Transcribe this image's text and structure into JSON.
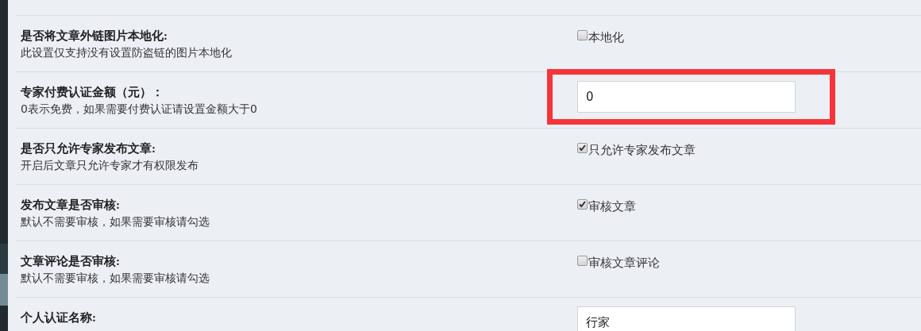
{
  "settings": [
    {
      "title": "是否将文章外链图片本地化:",
      "description": "此设置仅支持没有设置防盗链的图片本地化",
      "kind": "checkbox",
      "checked": false,
      "label": "本地化"
    },
    {
      "title": "专家付费认证金额（元）：",
      "description": "0表示免费，如果需要付费认证请设置金额大于0",
      "kind": "input",
      "value": "0",
      "highlighted": true
    },
    {
      "title": "是否只允许专家发布文章:",
      "description": "开启后文章只允许专家才有权限发布",
      "kind": "checkbox",
      "checked": true,
      "label": "只允许专家发布文章"
    },
    {
      "title": "发布文章是否审核:",
      "description": "默认不需要审核，如果需要审核请勾选",
      "kind": "checkbox",
      "checked": true,
      "label": "审核文章"
    },
    {
      "title": "文章评论是否审核:",
      "description": "默认不需要审核，如果需要审核请勾选",
      "kind": "checkbox",
      "checked": false,
      "label": "审核文章评论"
    },
    {
      "title": "个人认证名称:",
      "kind": "input",
      "value": "行家"
    }
  ]
}
